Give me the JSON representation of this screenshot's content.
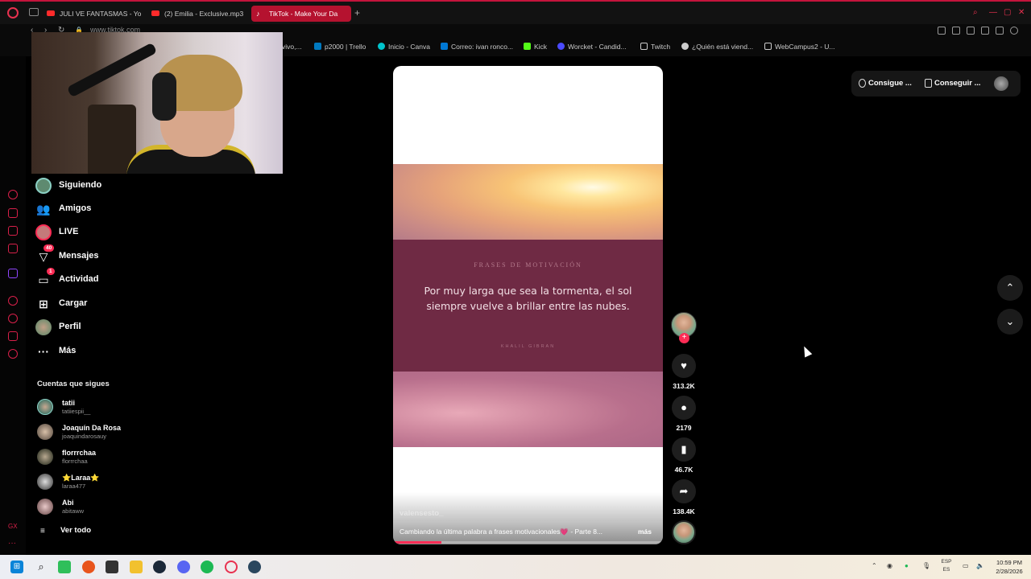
{
  "browser": {
    "tabs": [
      {
        "label": "JULI VE FANTASMAS - Yo",
        "icon": "youtube-icon"
      },
      {
        "label": "(2) Emilia - Exclusive.mp3",
        "icon": "youtube-icon"
      },
      {
        "label": "TikTok - Make Your Da",
        "icon": "tiktok-icon",
        "active": true
      }
    ],
    "new_tab": "+",
    "url": "www.tiktok.com",
    "bookmarks": [
      {
        "label": "vivo,...",
        "color": "#444"
      },
      {
        "label": "p2000 | Trello",
        "color": "#0079bf"
      },
      {
        "label": "Inicio - Canva",
        "color": "#00c4cc"
      },
      {
        "label": "Correo: ivan ronco...",
        "color": "#0078d4"
      },
      {
        "label": "Kick",
        "color": "#53fc18"
      },
      {
        "label": "Worcket - Candid...",
        "color": "#4a4aff"
      },
      {
        "label": "Twitch",
        "color": "#9146ff"
      },
      {
        "label": "¿Quién está viend...",
        "color": "#cccccc"
      },
      {
        "label": "WebCampus2 - U...",
        "color": "#dddddd"
      }
    ]
  },
  "nav": {
    "items": [
      {
        "label": "Siguiendo",
        "icon": "following-avatar-icon"
      },
      {
        "label": "Amigos",
        "icon": "friends-icon"
      },
      {
        "label": "LIVE",
        "icon": "live-icon"
      },
      {
        "label": "Mensajes",
        "icon": "messages-icon",
        "badge": "40"
      },
      {
        "label": "Actividad",
        "icon": "activity-icon",
        "badge": "1"
      },
      {
        "label": "Cargar",
        "icon": "upload-icon"
      },
      {
        "label": "Perfil",
        "icon": "profile-avatar-icon"
      },
      {
        "label": "Más",
        "icon": "more-icon"
      }
    ]
  },
  "following": {
    "title": "Cuentas que sigues",
    "accounts": [
      {
        "name": "tatii",
        "handle": "tatiiespii__"
      },
      {
        "name": "Joaquín Da Rosa",
        "handle": "joaquindarosauy"
      },
      {
        "name": "florrrchaa",
        "handle": "florrrchaa"
      },
      {
        "name": "⭐Laraa⭐",
        "handle": "laraa477"
      },
      {
        "name": "Abi",
        "handle": "abitaww"
      }
    ],
    "see_all": "Ver todo"
  },
  "video": {
    "title": "FRASES DE MOTIVACIÓN",
    "quote": "Por muy larga que sea la tormenta, el sol siempre vuelve a brillar entre las nubes.",
    "author": "KHALIL GIBRAN",
    "username": "valensesto_",
    "description": "Cambiando la última palabra a frases motivacionales💗 - Parte 8...",
    "more": "más",
    "progress": 0.18
  },
  "actions": {
    "follow_plus": "+",
    "likes": "313.2K",
    "comments": "2179",
    "saves": "46.7K",
    "shares": "138.4K"
  },
  "header_right": {
    "coins": "Consigue ...",
    "app": "Conseguir ..."
  },
  "taskbar": {
    "lang_top": "ESP",
    "lang_bottom": "ES",
    "time": "10:59 PM",
    "date": "2/28/2026"
  },
  "colors": {
    "accent": "#fe2c55",
    "browser_accent": "#c4143c",
    "band": "#6f2a44"
  }
}
